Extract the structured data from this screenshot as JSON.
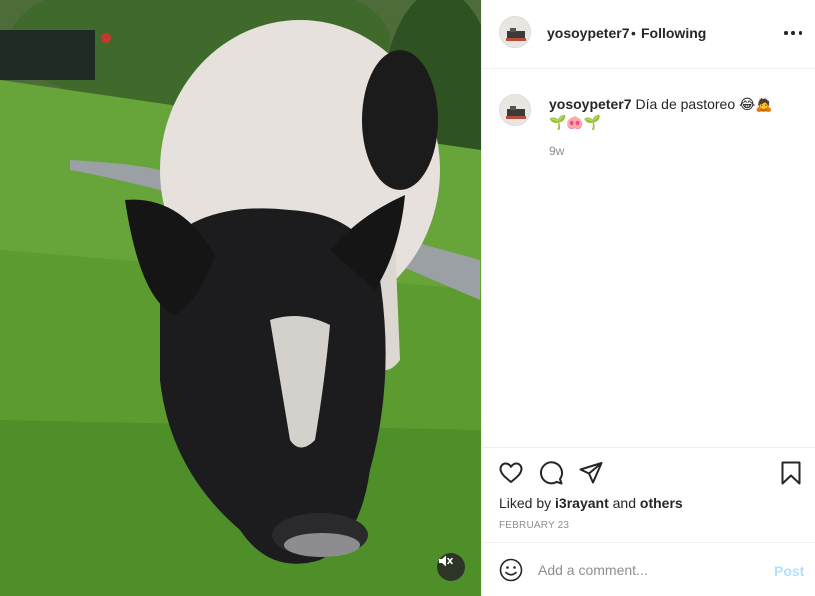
{
  "post": {
    "username": "yosoypeter7",
    "dot": "•",
    "follow_status": "Following",
    "caption": {
      "username": "yosoypeter7",
      "text": "Día de pastoreo 😂🙇",
      "emoji_line": "🌱🐽🌱",
      "time": "9w"
    },
    "likes": {
      "prefix": "Liked by",
      "user": "i3rayant",
      "and": "and",
      "others": "others"
    },
    "date": "FEBRUARY 23"
  },
  "comment": {
    "placeholder": "Add a comment...",
    "post_label": "Post"
  },
  "icons": {
    "more": "more-options-icon",
    "like": "heart-icon",
    "comment": "comment-bubble-icon",
    "share": "paper-plane-icon",
    "save": "bookmark-icon",
    "emoji": "smiley-icon",
    "mute": "speaker-muted-icon"
  },
  "colors": {
    "text": "#262626",
    "muted": "#8e8e8e",
    "post_disabled": "#b2dffc",
    "border": "#efefef"
  }
}
